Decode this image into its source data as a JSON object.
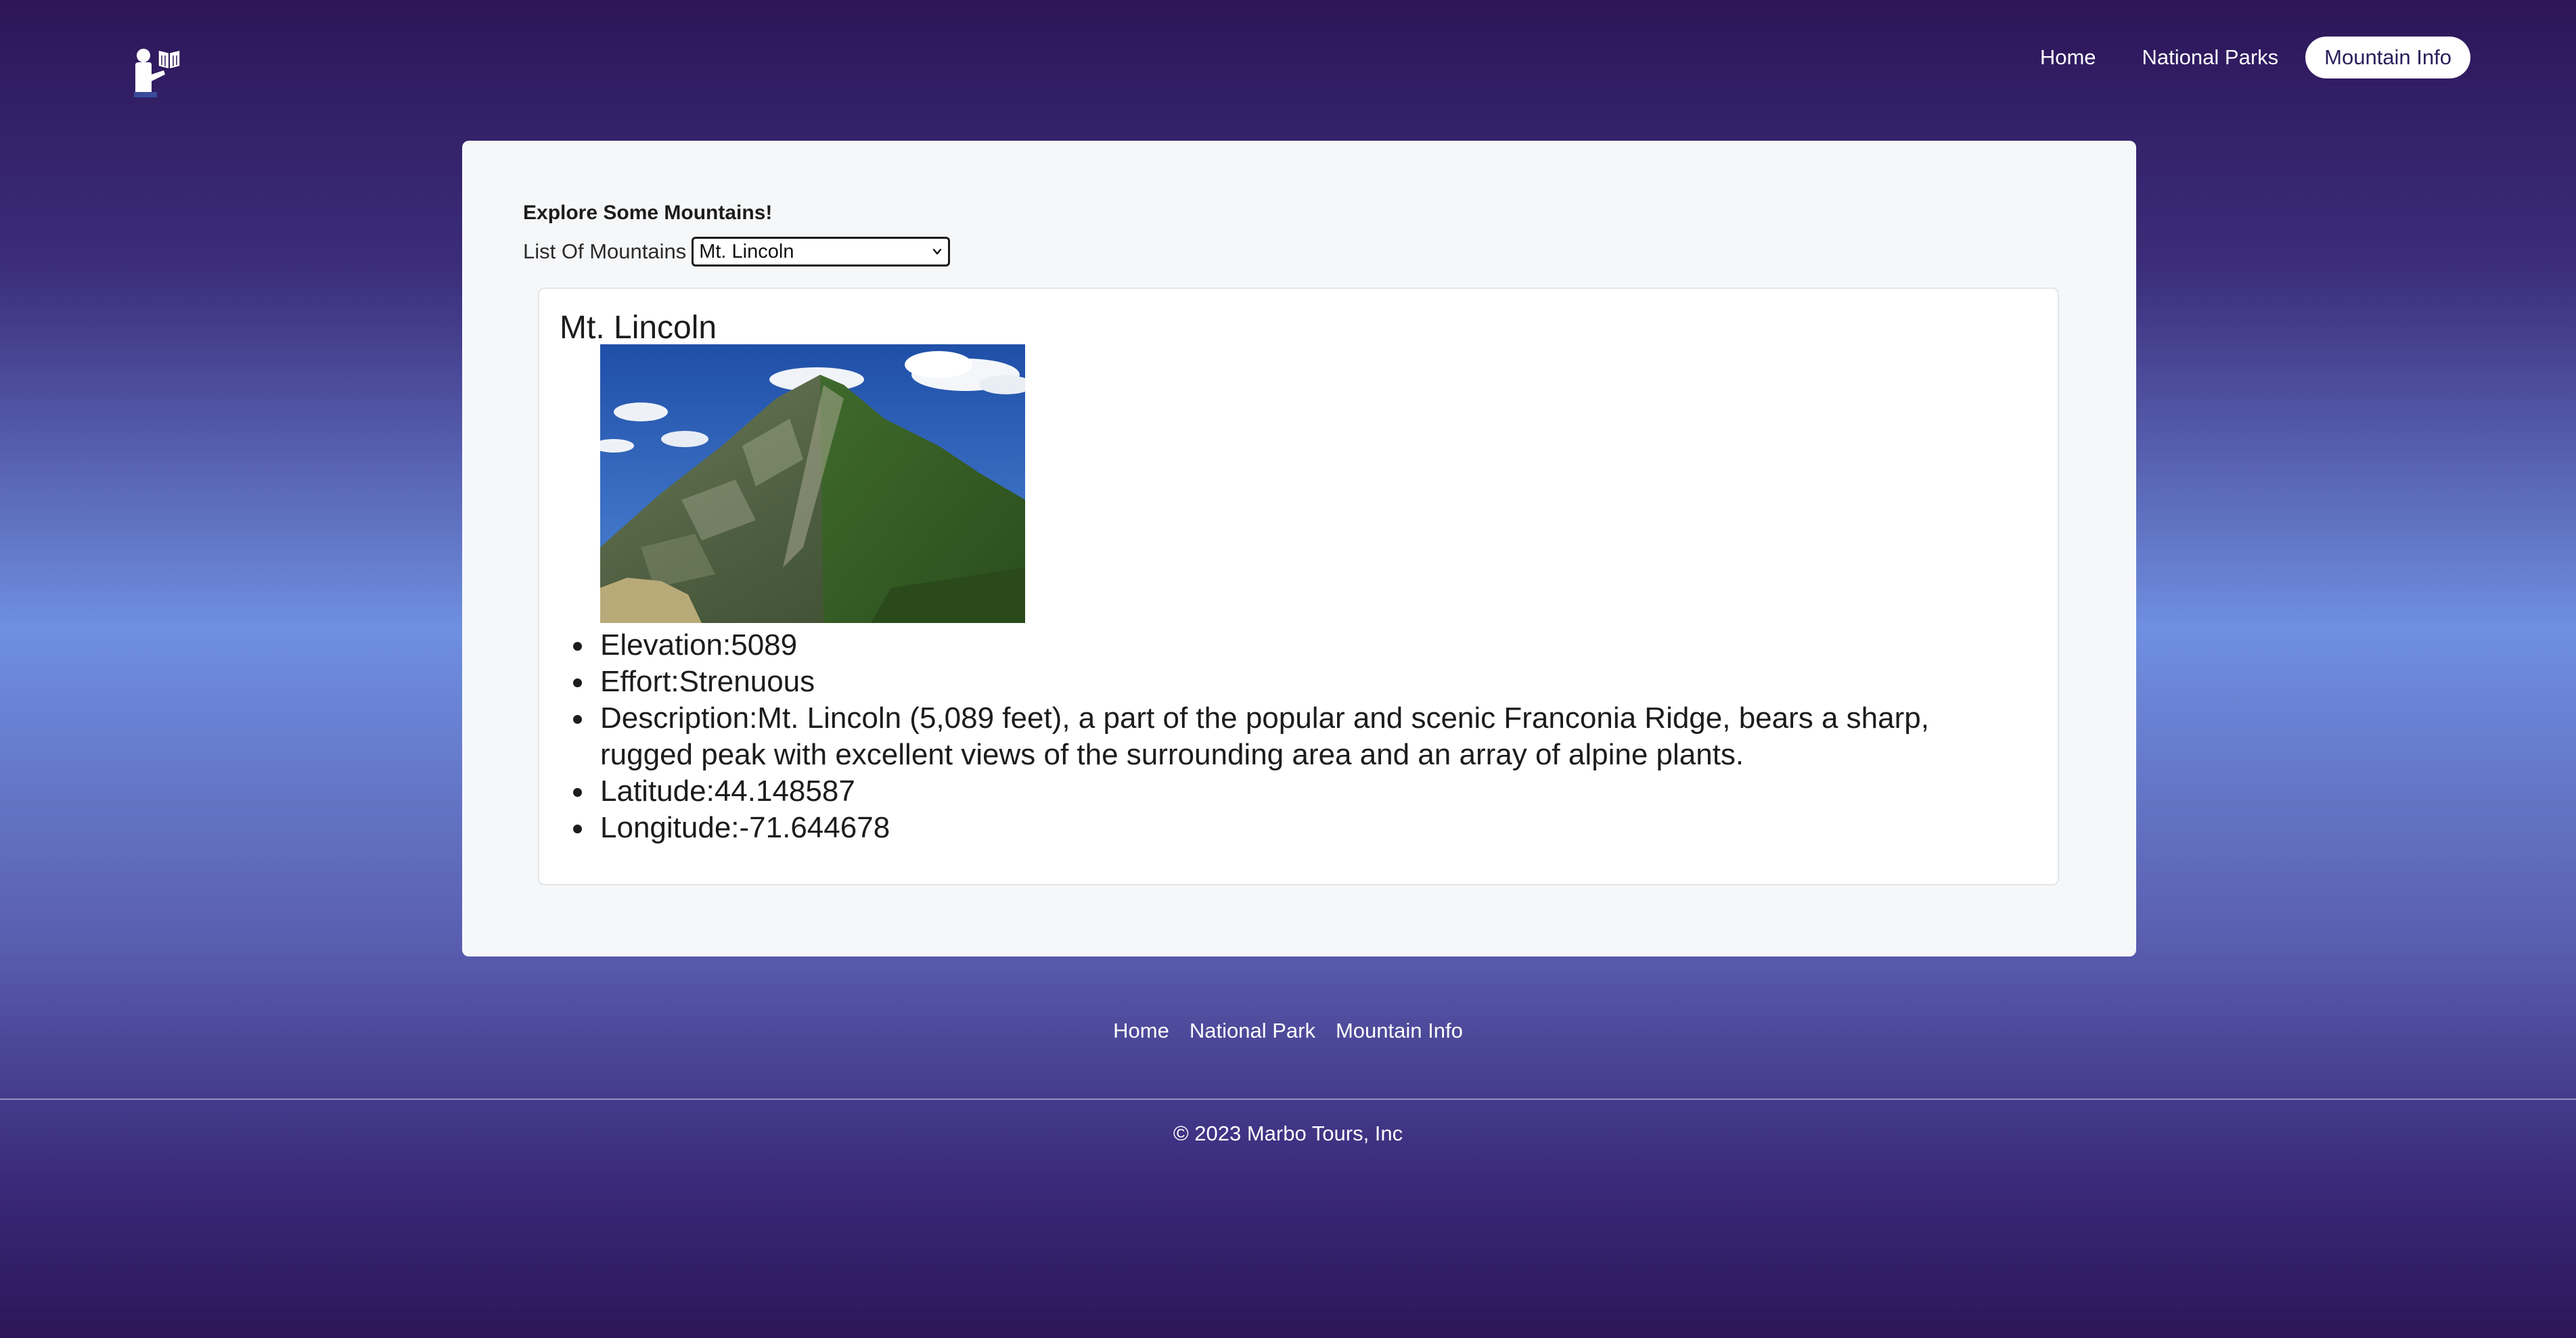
{
  "header": {
    "logo_icon": "tour-guide-icon",
    "nav": [
      {
        "label": "Home",
        "active": false
      },
      {
        "label": "National Parks",
        "active": false
      },
      {
        "label": "Mountain Info",
        "active": true
      }
    ]
  },
  "main": {
    "title": "Explore Some Mountains!",
    "select_label": "List Of Mountains",
    "selected_mountain": "Mt. Lincoln",
    "detail": {
      "name": "Mt. Lincoln",
      "image_icon": "mountain-photo",
      "facts": [
        "Elevation:5089",
        "Effort:Strenuous",
        "Description:Mt. Lincoln (5,089 feet), a part of the popular and scenic Franconia Ridge, bears a sharp, rugged peak with excellent views of the surrounding area and an array of alpine plants.",
        "Latitude:44.148587",
        "Longitude:-71.644678"
      ]
    }
  },
  "footer": {
    "links": [
      "Home",
      "National Park",
      "Mountain Info"
    ],
    "copyright": "© 2023 Marbo Tours, Inc"
  },
  "colors": {
    "bg_top": "#2d1659",
    "bg_mid": "#6f8fe0",
    "card_bg": "#f6f7f9",
    "active_nav_bg": "#ffffff",
    "active_nav_text": "#2a1f5c"
  }
}
